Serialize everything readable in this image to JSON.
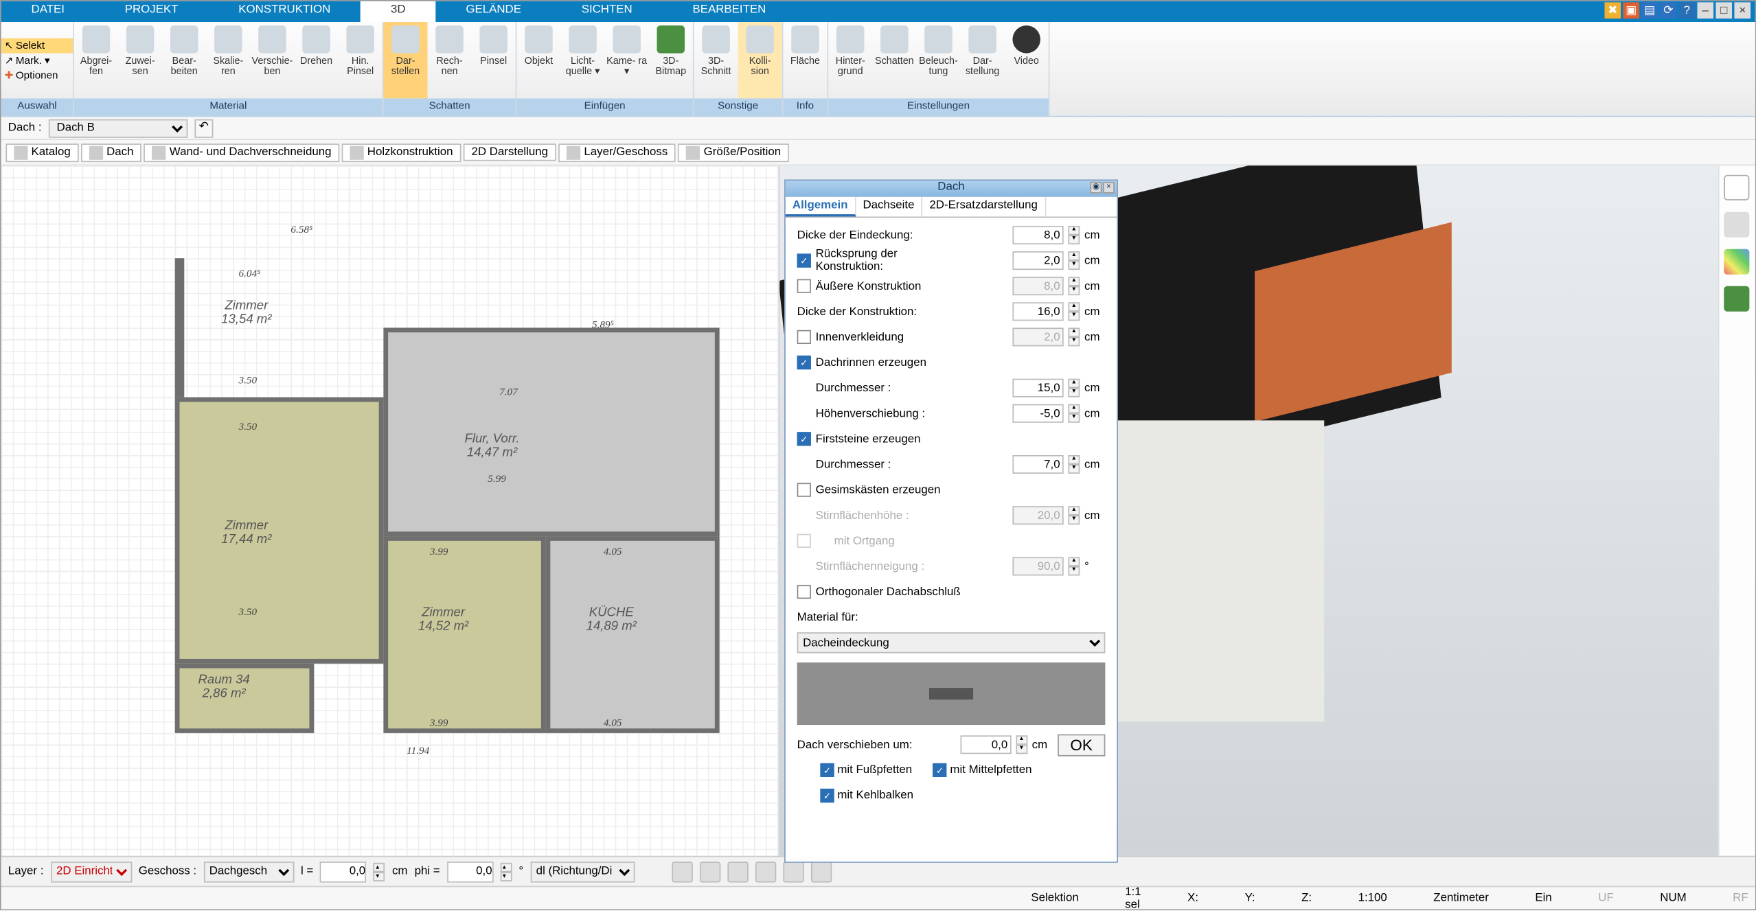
{
  "menu": {
    "datei": "DATEI",
    "projekt": "PROJEKT",
    "konstruktion": "KONSTRUKTION",
    "dd": "3D",
    "gelaende": "GELÄNDE",
    "sichten": "SICHTEN",
    "bearbeiten": "BEARBEITEN"
  },
  "side": {
    "selekt": "Selekt",
    "mark": "Mark. ▾",
    "optionen": "Optionen",
    "label": "Auswahl"
  },
  "ribbon": {
    "material": "Material",
    "schatten": "Schatten",
    "einfuegen": "Einfügen",
    "sonstige": "Sonstige",
    "info": "Info",
    "einstellungen": "Einstellungen",
    "abgreifen": "Abgrei-\nfen",
    "zuweisen": "Zuwei-\nsen",
    "bearbeiten": "Bear-\nbeiten",
    "skalieren": "Skalie-\nren",
    "verschieben": "Verschie-\nben",
    "drehen": "Drehen",
    "hinpinsel": "Hin.\nPinsel",
    "darstellen": "Dar-\nstellen",
    "rechnen": "Rech-\nnen",
    "pinsel": "Pinsel",
    "objekt": "Objekt",
    "lichtquelle": "Licht-\nquelle ▾",
    "kamera": "Kame-\nra ▾",
    "bitmap": "3D-\nBitmap",
    "schnitt": "3D-\nSchnitt",
    "kollision": "Kolli-\nsion",
    "flaeche": "Fläche",
    "hintergrund": "Hinter-\ngrund",
    "schatten2": "Schatten",
    "beleuchtung": "Beleuch-\ntung",
    "darstellung": "Dar-\nstellung",
    "video": "Video"
  },
  "sub": {
    "dach": "Dach :",
    "dachb": "Dach B"
  },
  "tokens": {
    "katalog": "Katalog",
    "dach": "Dach",
    "wand": "Wand- und Dachverschneidung",
    "holz": "Holzkonstruktion",
    "d2": "2D Darstellung",
    "layer": "Layer/Geschoss",
    "groesse": "Größe/Position"
  },
  "dialog": {
    "title": "Dach",
    "tabs": {
      "allgemein": "Allgemein",
      "dachseite": "Dachseite",
      "ersatz": "2D-Ersatzdarstellung"
    },
    "dicke_eindeckung": "Dicke der Eindeckung:",
    "dicke_eindeckung_v": "8,0",
    "ruecksprung": "Rücksprung der\nKonstruktion:",
    "ruecksprung_v": "2,0",
    "aeussere": "Äußere Konstruktion",
    "aeussere_v": "8,0",
    "dicke_konstr": "Dicke der Konstruktion:",
    "dicke_konstr_v": "16,0",
    "innen": "Innenverkleidung",
    "innen_v": "2,0",
    "dachrinnen": "Dachrinnen erzeugen",
    "durchmesser": "Durchmesser :",
    "durchmesser_v": "15,0",
    "hoehe": "Höhenverschiebung :",
    "hoehe_v": "-5,0",
    "first": "Firststeine erzeugen",
    "first_d": "Durchmesser :",
    "first_v": "7,0",
    "gesims": "Gesimskästen erzeugen",
    "stirnh": "Stirnflächenhöhe :",
    "stirnh_v": "20,0",
    "ortgang": "mit Ortgang",
    "stirnn": "Stirnflächenneigung :",
    "stirnn_v": "90,0",
    "ortho": "Orthogonaler Dachabschluß",
    "material": "Material für:",
    "mat_v": "Dacheindeckung",
    "verschieben": "Dach verschieben um:",
    "verschieben_v": "0,0",
    "ok": "OK",
    "fuss": "mit Fußpfetten",
    "mittel": "mit Mittelpfetten",
    "kehl": "mit Kehlbalken",
    "cm": "cm",
    "deg": "°"
  },
  "plan": {
    "d658": "6.58⁵",
    "d604": "6.04⁵",
    "d589": "5.89⁵",
    "d1194": "11.94",
    "d707": "7.07",
    "d599": "5.99",
    "d399": "3.99",
    "d405": "4.05",
    "d350": "3.50",
    "zimmer1": "Zimmer",
    "z1a": "13,54 m²",
    "zimmer2": "Zimmer",
    "z2a": "17,44 m²",
    "zimmer3": "Zimmer",
    "z3a": "14,52 m²",
    "kueche": "KÜCHE",
    "ka": "14,89 m²",
    "flur": "Flur, Vorr.",
    "fa": "14,47 m²",
    "raum": "Raum 34",
    "ra": "2,86 m²"
  },
  "bottom": {
    "layer": "Layer :",
    "layer_v": "2D Einricht",
    "geschoss": "Geschoss :",
    "geschoss_v": "Dachgesch",
    "l": "l =",
    "lv": "0,0",
    "cm": "cm",
    "phi": "phi =",
    "phiv": "0,0",
    "deg": "°",
    "dl": "dl (Richtung/Di"
  },
  "status": {
    "sel": "Selektion",
    "ratio": "1:1 sel",
    "x": "X:",
    "y": "Y:",
    "z": "Z:",
    "scale": "1:100",
    "unit": "Zentimeter",
    "ein": "Ein",
    "uf": "UF",
    "num": "NUM",
    "rf": "RF"
  }
}
